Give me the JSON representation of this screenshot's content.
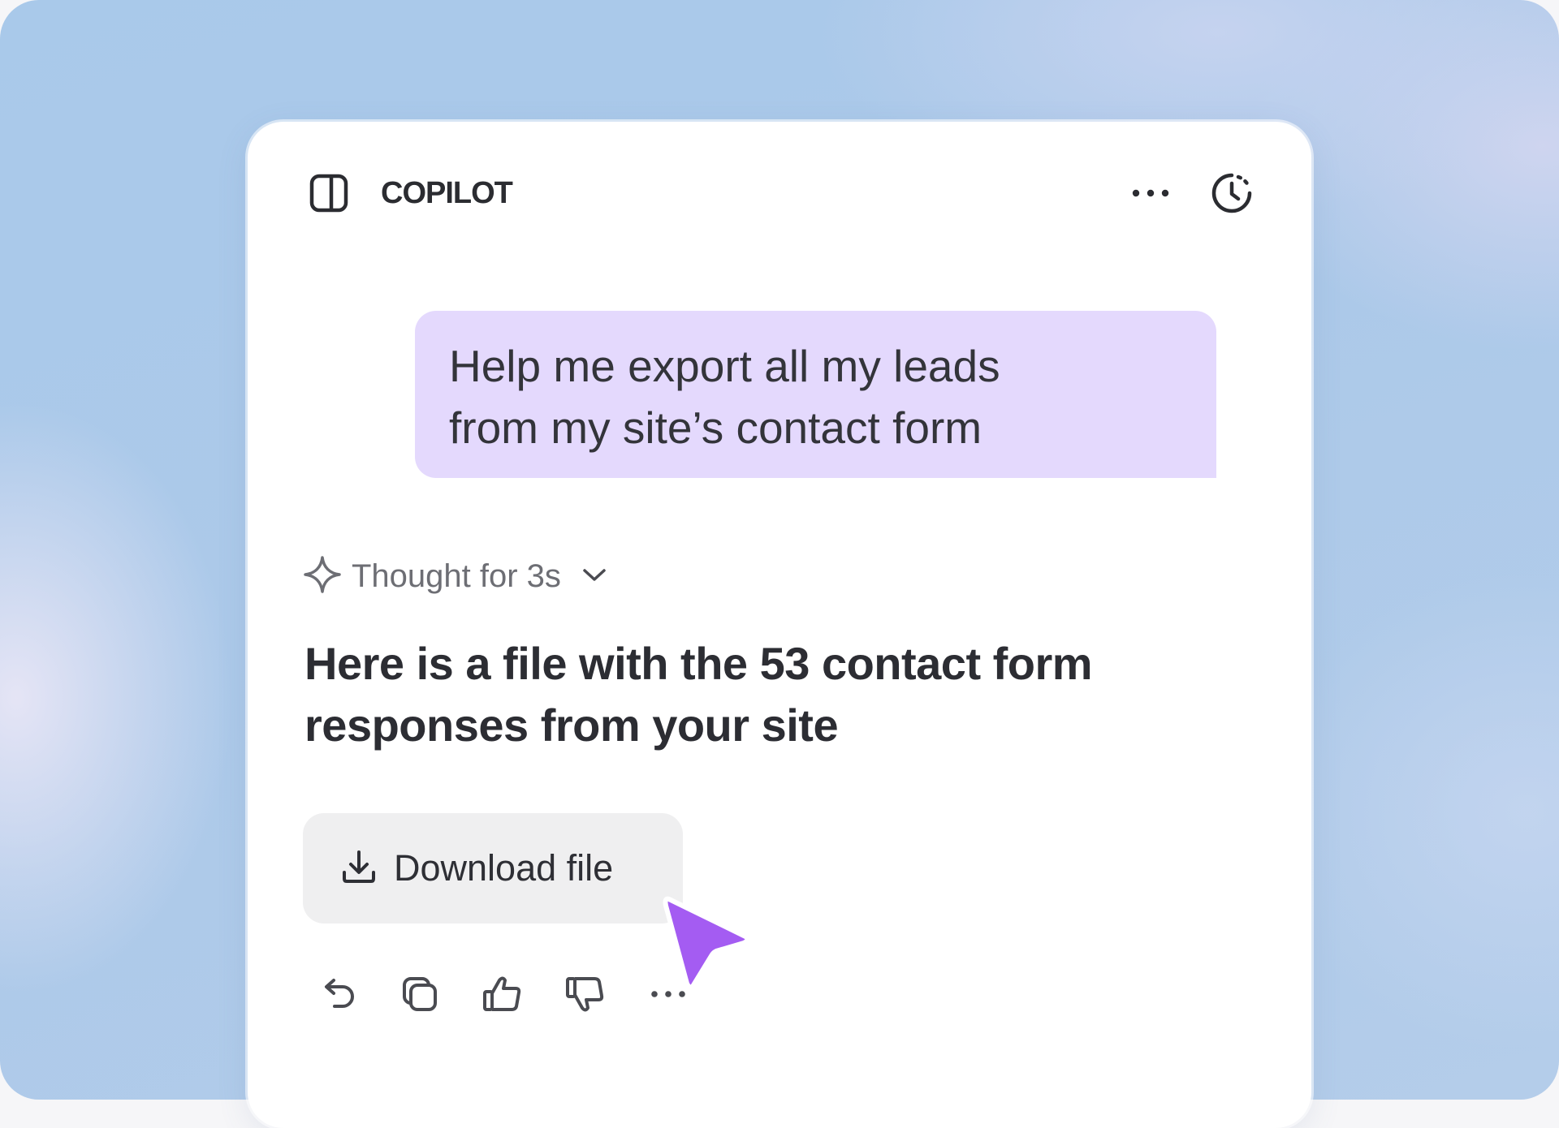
{
  "header": {
    "title": "COPILOT",
    "icons": [
      "panel-toggle-icon",
      "more-icon",
      "history-icon"
    ]
  },
  "conversation": {
    "user_message": "Help me export all my leads\nfrom my site’s contact form",
    "thought": {
      "label": "Thought for 3s",
      "icons": [
        "sparkle-icon",
        "chevron-down-icon"
      ]
    },
    "assistant_message": "Here is a file with the 53 contact form\nresponses from your site",
    "download_button": {
      "label": "Download file",
      "icon": "download-icon"
    }
  },
  "actions": [
    "undo-icon",
    "copy-icon",
    "thumbs-up-icon",
    "thumbs-down-icon",
    "more-icon"
  ],
  "colors": {
    "background": "#acc9e9",
    "user_bubble": "#e4d9fd",
    "download_button": "#efeff0",
    "cursor": "#a45cf2",
    "text": "#2c2d33",
    "muted_text": "#6d6e74"
  }
}
